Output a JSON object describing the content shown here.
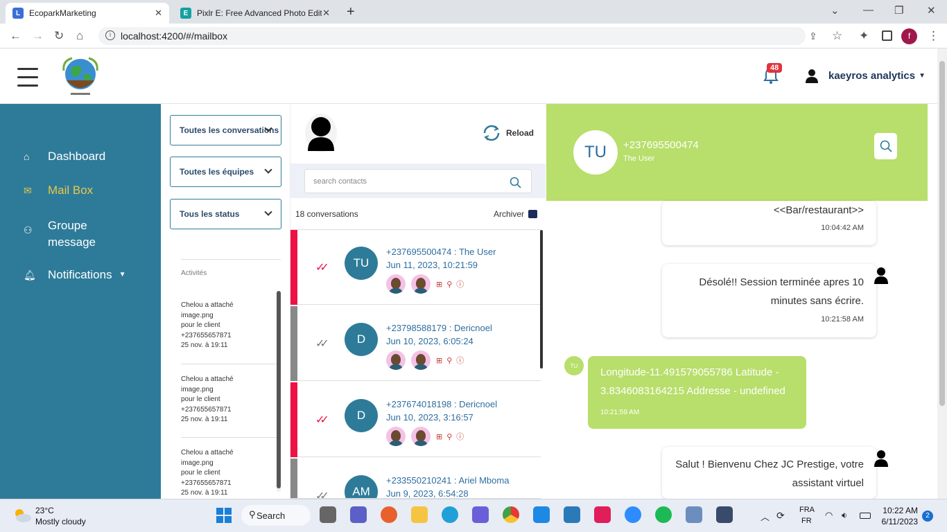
{
  "browser": {
    "tabs": [
      {
        "title": "EcoparkMarketing",
        "active": true
      },
      {
        "title": "Pixlr E: Free Advanced Photo Edit",
        "active": false
      }
    ],
    "url": "localhost:4200/#/mailbox",
    "profile_initial": "f"
  },
  "header": {
    "notification_count": "48",
    "user_name": "kaeyros analytics"
  },
  "sidebar": {
    "items": [
      {
        "label": "Dashboard",
        "icon": "home-icon",
        "active": false
      },
      {
        "label": "Mail Box",
        "icon": "mail-icon",
        "active": true
      },
      {
        "label": "Groupe message",
        "icon": "group-icon",
        "active": false
      },
      {
        "label": "Notifications",
        "icon": "bell-icon",
        "active": false
      }
    ],
    "active_color": "#e7c84a",
    "bg_color": "#2e7b99"
  },
  "filters": {
    "conversations": "Toutes les conversations",
    "equipes": "Toutes les équipes",
    "status": "Tous les status",
    "activities_label": "Activités",
    "activities": [
      {
        "line1": "Chelou a attaché",
        "line2": "image.png",
        "line3": "pour le client",
        "line4": "+237655657871",
        "line5": "25 nov. à 19:11"
      },
      {
        "line1": "Chelou a attaché",
        "line2": "image.png",
        "line3": "pour le client",
        "line4": "+237655657871",
        "line5": "25 nov. à 19:11"
      },
      {
        "line1": "Chelou a attaché",
        "line2": "image.png",
        "line3": "pour le client",
        "line4": "+237655657871",
        "line5": "25 nov. à 19:11"
      }
    ]
  },
  "conversations": {
    "reload_label": "Reload",
    "search_placeholder": "search contacts",
    "count_label": "18 conversations",
    "archive_label": "Archiver",
    "items": [
      {
        "initials": "TU",
        "title": "+237695500474 : The User",
        "date": "Jun 11, 2023, 10:21:59",
        "status_color": "#ee1144",
        "read": true
      },
      {
        "initials": "D",
        "title": "+23798588179 : Dericnoel",
        "date": "Jun 10, 2023, 6:05:24",
        "status_color": "#888888",
        "read": false
      },
      {
        "initials": "D",
        "title": "+237674018198 : Dericnoel",
        "date": "Jun 10, 2023, 3:16:57",
        "status_color": "#ee1144",
        "read": true
      },
      {
        "initials": "AM",
        "title": "+233550210241 : Ariel Mboma",
        "date": "Jun 9, 2023, 6:54:28",
        "status_color": "#888888",
        "read": false
      }
    ]
  },
  "chat": {
    "initials": "TU",
    "phone": "+237695500474",
    "name": "The User",
    "header_color": "#b8de6b",
    "messages": [
      {
        "type": "bot",
        "text": "<<Bar/restaurant>>",
        "time": "10:04:42 AM"
      },
      {
        "type": "bot",
        "line1": "Désolé!! Session terminée apres 10",
        "line2": "minutes sans écrire.",
        "time": "10:21:58 AM"
      },
      {
        "type": "user",
        "avatar": "TU",
        "line1": "Longitude-11.491579055786 Latitude -",
        "line2": "3.8346083164215 Addresse - undefined",
        "time": "10:21:59 AM"
      },
      {
        "type": "bot",
        "line1": "Salut ! Bienvenu Chez JC Prestige, votre",
        "line2": "assistant virtuel"
      }
    ]
  },
  "taskbar": {
    "temp": "23°C",
    "weather": "Mostly cloudy",
    "search_label": "Search",
    "lang1": "FRA",
    "lang2": "FR",
    "time": "10:22 AM",
    "date": "6/11/2023",
    "notif": "2"
  }
}
